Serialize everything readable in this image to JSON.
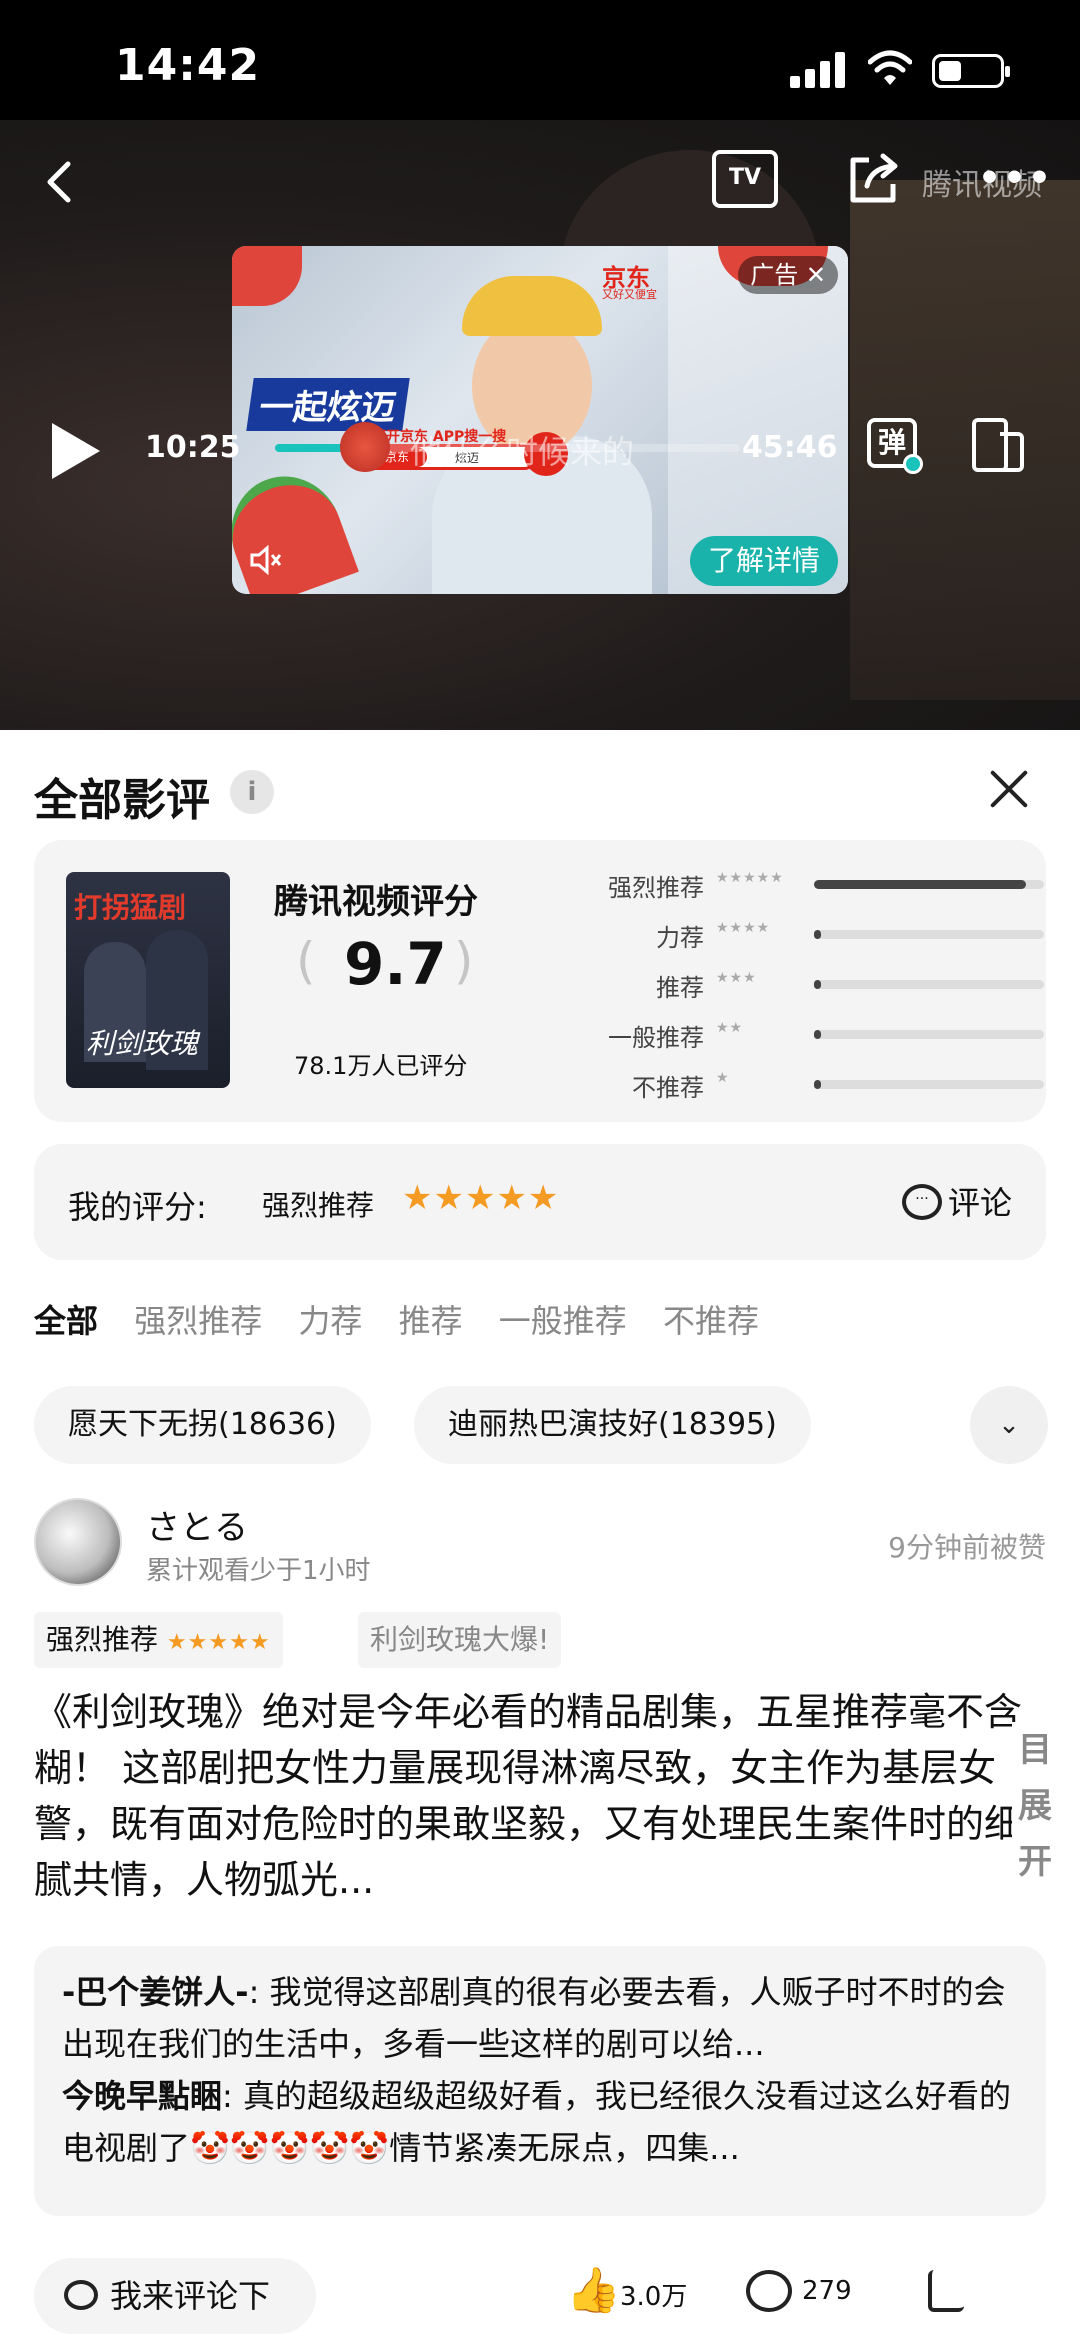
{
  "status": {
    "time": "14:42"
  },
  "video": {
    "tv_label": "TV",
    "watermark": "腾讯视频",
    "ad": {
      "slogan": "一起炫迈",
      "badge": "广告 ✕",
      "brand": "京东",
      "brand_sub": "又好又便宜",
      "open_text": "打开京东 APP搜一搜",
      "search_brand": "京东",
      "search_query": "炫迈",
      "detail_button": "了解详情"
    },
    "current_time": "10:25",
    "total_time": "45:46",
    "progress_fraction": 0.15,
    "danmu_text": "他什么时候来的",
    "danmu_button": "弹"
  },
  "panel": {
    "title": "全部影评",
    "info_icon": "i",
    "score_card": {
      "poster_title_top": "打拐猛剧",
      "poster_title_bottom": "利剑玫瑰",
      "title": "腾讯视频评分",
      "score": "9.7",
      "count": "78.1万人已评分",
      "distribution": [
        {
          "label": "强烈推荐",
          "stars": "★★★★★",
          "fraction": 0.92
        },
        {
          "label": "力荐",
          "stars": "★★★★",
          "fraction": 0.03
        },
        {
          "label": "推荐",
          "stars": "★★★",
          "fraction": 0.03
        },
        {
          "label": "一般推荐",
          "stars": "★★",
          "fraction": 0.03
        },
        {
          "label": "不推荐",
          "stars": "★",
          "fraction": 0.03
        }
      ]
    },
    "my_score": {
      "label": "我的评分:",
      "value": "强烈推荐",
      "stars": "★★★★★",
      "comment_label": "评论"
    },
    "filters": [
      "全部",
      "强烈推荐",
      "力荐",
      "推荐",
      "一般推荐",
      "不推荐"
    ],
    "tags": [
      "愿天下无拐(18636)",
      "迪丽热巴演技好(18395)"
    ],
    "review": {
      "username": "さとる",
      "subtitle": "累计观看少于1小时",
      "liked": "9分钟前被赞",
      "rating_label": "强烈推荐",
      "rating_stars": "★★★★★",
      "tag": "利剑玫瑰大爆!",
      "body": "《利剑玫瑰》绝对是今年必看的精品剧集，五星推荐毫不含糊！ 这部剧把女性力量展现得淋漓尽致，女主作为基层女警，既有面对危险时的果敢坚毅，又有处理民生案件时的细腻共情，人物弧光...",
      "expand": "目展开"
    },
    "replies": [
      {
        "user": "-巴个姜饼人-",
        "text": ": 我觉得这部剧真的很有必要去看，人贩子时不时的会出现在我们的生活中，多看一些这样的剧可以给..."
      },
      {
        "user": "今晚早點睏",
        "text": ": 真的超级超级超级好看，我已经很久没看过这么好看的电视剧了🤡🤡🤡🤡🤡情节紧凑无尿点，四集..."
      }
    ],
    "bottom": {
      "comment_placeholder": "我来评论下",
      "likes": "3.0万",
      "comments": "279"
    }
  }
}
